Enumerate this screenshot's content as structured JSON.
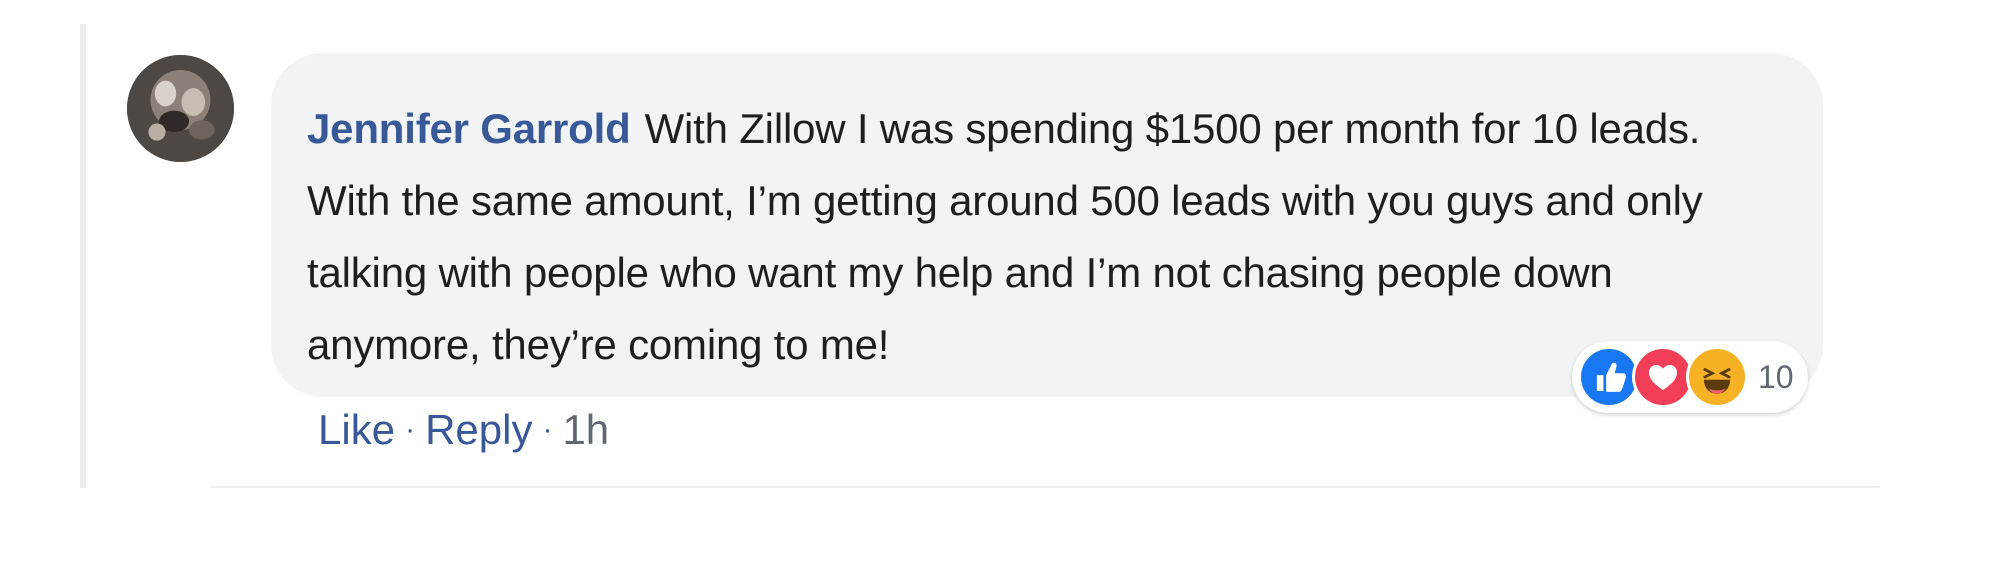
{
  "comment": {
    "author": "Jennifer Garrold",
    "text": "With Zillow I was spending $1500 per month for 10 leads. With the same amount, I’m getting around 500 leads with you guys and only talking with people who want my help and I’m not chasing people down anymore, they’re coming to me!"
  },
  "reactions": {
    "icons": [
      "thumbs-up-icon",
      "heart-icon",
      "laughing-face-icon"
    ],
    "count": "10"
  },
  "actions": {
    "like_label": "Like",
    "reply_label": "Reply",
    "separator": "·",
    "timestamp": "1h"
  },
  "colors": {
    "author_link": "#385898",
    "bubble_bg": "#f2f3f5",
    "like": "#1877f2",
    "love": "#f33e58",
    "haha": "#f7b125"
  }
}
